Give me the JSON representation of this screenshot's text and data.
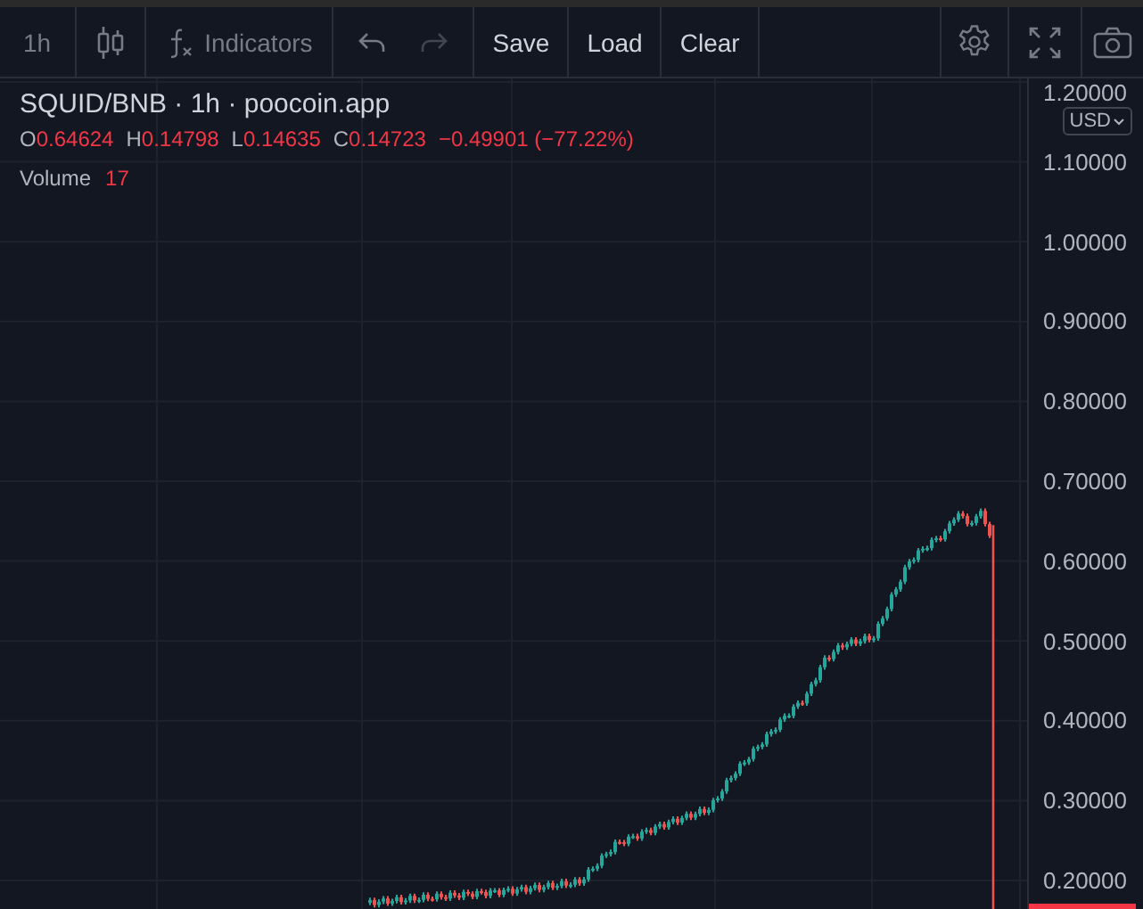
{
  "toolbar": {
    "interval": "1h",
    "indicators": "Indicators",
    "undo": {
      "disabled": false
    },
    "redo": {
      "disabled": true
    },
    "actions": [
      "Save",
      "Load",
      "Clear"
    ]
  },
  "legend": {
    "title": "SQUID/BNB · 1h · poocoin.app",
    "ohlc": [
      {
        "label": "O",
        "value": "0.64624"
      },
      {
        "label": "H",
        "value": "0.14798"
      },
      {
        "label": "L",
        "value": "0.14635"
      },
      {
        "label": "C",
        "value": "0.14723"
      }
    ],
    "change": "−0.49901 (−77.22%)",
    "volume_label": "Volume",
    "volume": "17"
  },
  "price_axis": {
    "currency": "USD",
    "labels": [
      "1.20000",
      "1.10000",
      "1.00000",
      "0.90000",
      "0.80000",
      "0.70000",
      "0.60000",
      "0.50000",
      "0.40000",
      "0.30000",
      "0.20000"
    ]
  }
}
